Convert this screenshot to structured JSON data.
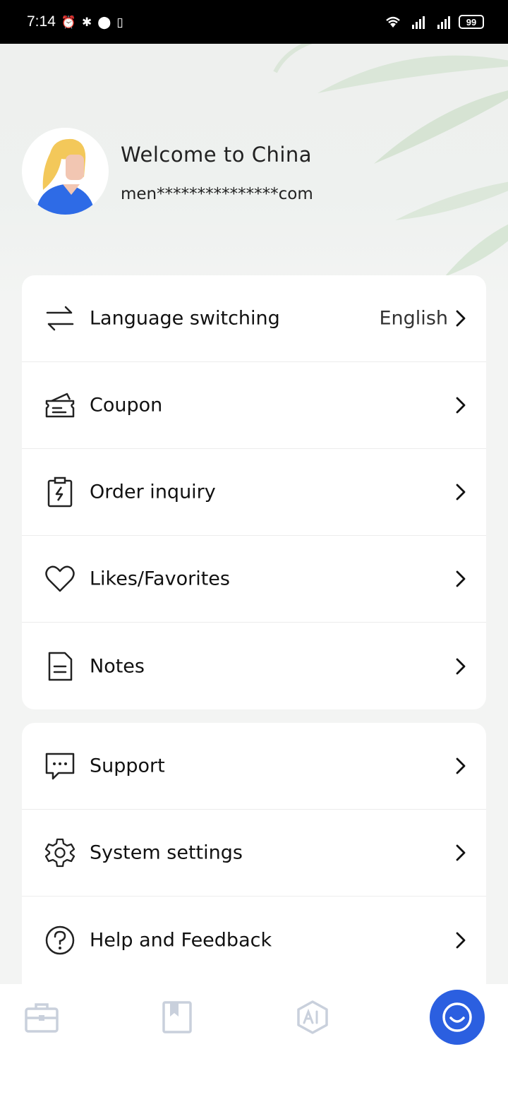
{
  "status_bar": {
    "time": "7:14",
    "left_icons": [
      "alarm-icon",
      "bluetooth-icon",
      "location-icon",
      "vibrate-icon"
    ],
    "right_icons": [
      "wifi-icon",
      "signal-4g-icon",
      "signal-4g-icon"
    ],
    "battery": "99"
  },
  "profile": {
    "welcome": "Welcome to China",
    "email": "men***************com"
  },
  "menu_primary": [
    {
      "label": "Language switching",
      "value": "English",
      "icon": "swap-arrows-icon"
    },
    {
      "label": "Coupon",
      "value": "",
      "icon": "ticket-icon"
    },
    {
      "label": "Order inquiry",
      "value": "",
      "icon": "clipboard-icon"
    },
    {
      "label": "Likes/Favorites",
      "value": "",
      "icon": "heart-icon"
    },
    {
      "label": "Notes",
      "value": "",
      "icon": "document-icon"
    }
  ],
  "menu_secondary": [
    {
      "label": "Support",
      "icon": "chat-bubble-icon"
    },
    {
      "label": "System settings",
      "icon": "gear-icon"
    },
    {
      "label": "Help and Feedback",
      "icon": "question-circle-icon"
    }
  ],
  "bottom_nav": [
    {
      "name": "toolbox",
      "icon": "briefcase-icon"
    },
    {
      "name": "bookmarks",
      "icon": "bookmark-icon"
    },
    {
      "name": "ai",
      "icon": "ai-hexagon-icon"
    },
    {
      "name": "profile",
      "icon": "smile-icon",
      "active": true
    }
  ],
  "colors": {
    "accent": "#2b5fe0",
    "nav_inactive": "#c9d0dc",
    "avatar_hair": "#f3c85a",
    "avatar_shirt": "#2e6be6"
  }
}
